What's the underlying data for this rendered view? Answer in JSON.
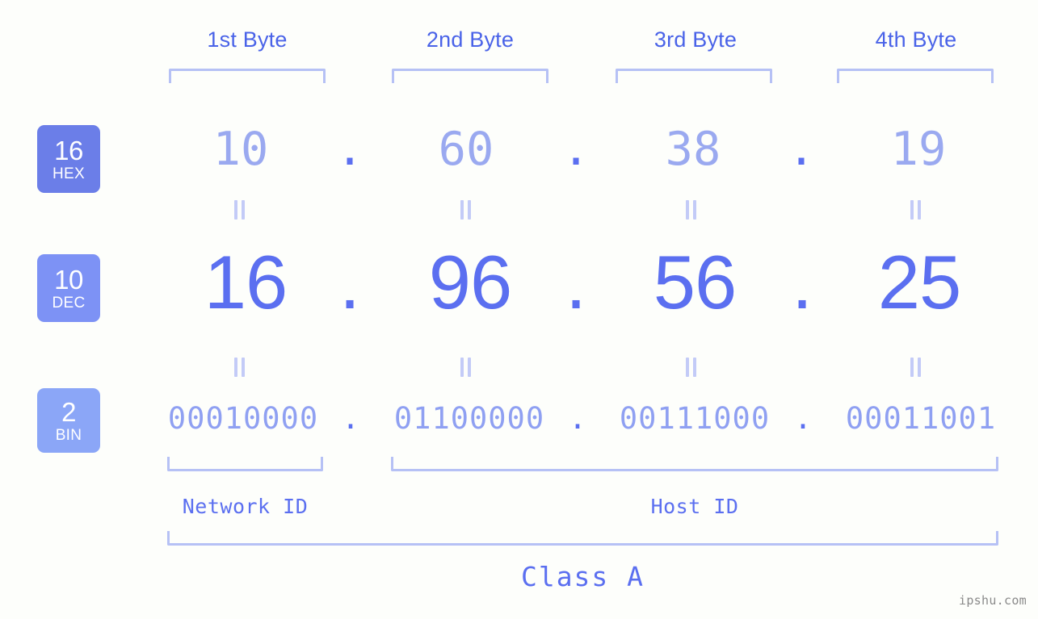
{
  "background_color": "#fdfefb",
  "accent_colors": {
    "bracket": "#b6c1f5",
    "header_text": "#4a63e8",
    "hex_value": "#9aa9f0",
    "dec_value": "#5b6ff0",
    "bin_value": "#8fa0f2",
    "equals_mark": "#c3cbf7",
    "badge_hex": "#6b7ee8",
    "badge_dec": "#7d92f5",
    "badge_bin": "#8ba6f7",
    "watermark": "#8a8a8a"
  },
  "header": {
    "byte_labels": [
      "1st Byte",
      "2nd Byte",
      "3rd Byte",
      "4th Byte"
    ]
  },
  "rows": [
    {
      "badge_number": "16",
      "badge_name": "HEX",
      "base": 16,
      "values": [
        "10",
        "60",
        "38",
        "19"
      ],
      "separator": "."
    },
    {
      "badge_number": "10",
      "badge_name": "DEC",
      "base": 10,
      "values": [
        "16",
        "96",
        "56",
        "25"
      ],
      "separator": "."
    },
    {
      "badge_number": "2",
      "badge_name": "BIN",
      "base": 2,
      "values": [
        "00010000",
        "01100000",
        "00111000",
        "00011001"
      ],
      "separator": "."
    }
  ],
  "equals_marks": {
    "symbol": "||",
    "count_per_row": 4
  },
  "footer": {
    "network_id_label": "Network ID",
    "host_id_label": "Host ID",
    "class_label": "Class A",
    "watermark": "ipshu.com"
  },
  "address": {
    "hex": "10.60.38.19",
    "dec": "16.96.56.25",
    "bin": "00010000.01100000.00111000.00011001"
  }
}
